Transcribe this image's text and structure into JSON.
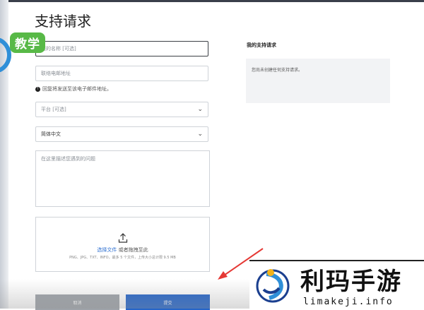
{
  "page_title": "支持请求",
  "form": {
    "name_placeholder": "您的名称 [可选]",
    "email_placeholder": "联络电邮地址",
    "email_hint": "回复将发送至该电子邮件地址。",
    "platform_placeholder": "平台 [可选]",
    "language_value": "简体中文",
    "description_placeholder": "在这里描述您遇到的问题",
    "upload_link": "选择文件",
    "upload_text": " 或者拖拽至此",
    "upload_limits": "PNG、JPG、TXT、INFO，最多 5 个文件，上传大小总计限 9.5 MB",
    "cancel_label": "取消",
    "submit_label": "提交"
  },
  "sidebar": {
    "title": "我的支持请求",
    "empty_text": "您尚未创建任何支持请求。"
  },
  "overlay": {
    "badge_text": "教学",
    "watermark_title": "利玛手游",
    "watermark_url": "limakeji.info"
  },
  "colors": {
    "primary": "#2565c9",
    "cancel": "#9ea3a9",
    "badge": "#58b947",
    "link": "#2d6fd0"
  },
  "icons": [
    "upload-icon",
    "chevron-down-icon",
    "info-icon",
    "arrow-annotation"
  ]
}
